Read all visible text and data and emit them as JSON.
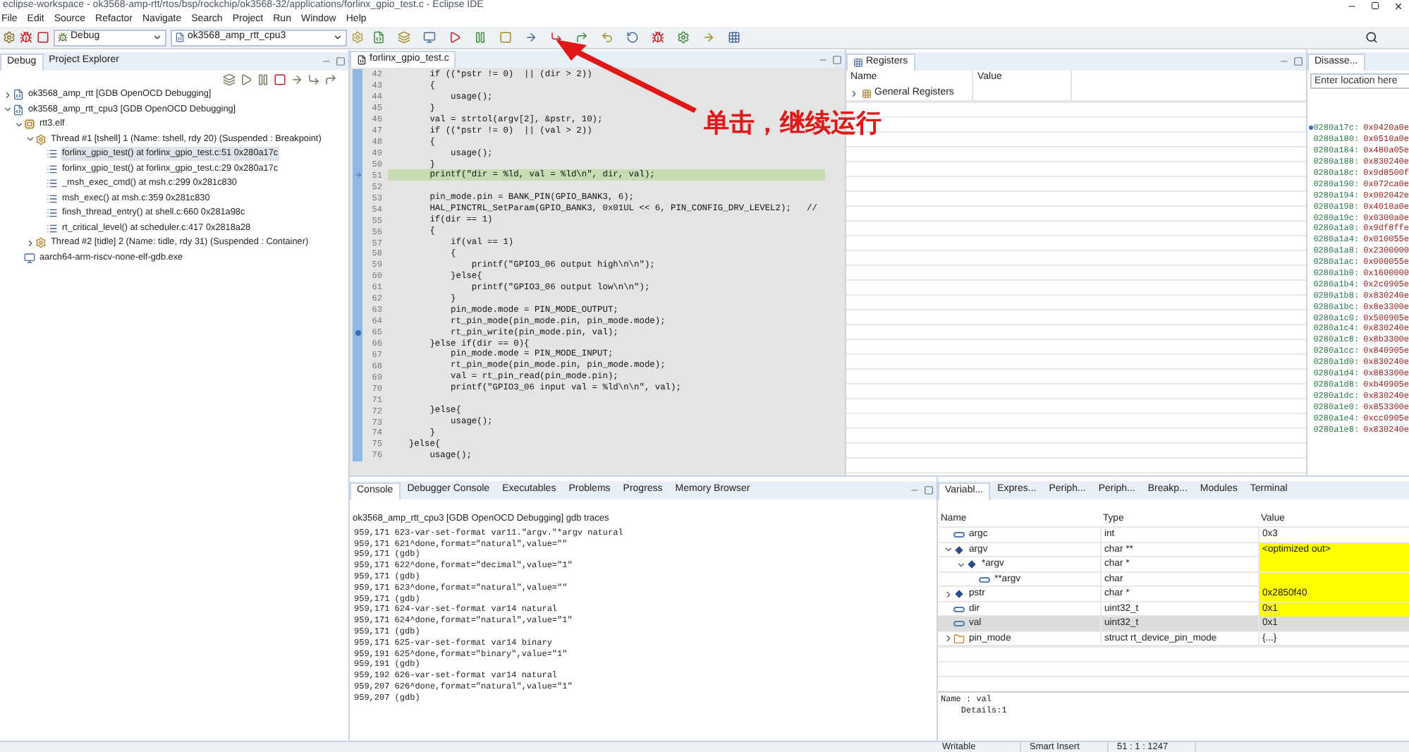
{
  "window": {
    "title": "eclipse-workspace - ok3568-amp-rtt/rtos/bsp/rockchip/ok3568-32/applications/forlinx_gpio_test.c - Eclipse IDE"
  },
  "menu": [
    "File",
    "Edit",
    "Source",
    "Refactor",
    "Navigate",
    "Search",
    "Project",
    "Run",
    "Window",
    "Help"
  ],
  "toolbar": {
    "mode": "Debug",
    "config": "ok3568_amp_rtt_cpu3"
  },
  "debug_panel": {
    "tabs": [
      {
        "label": "Debug",
        "selected": true
      },
      {
        "label": "Project Explorer",
        "selected": false
      }
    ],
    "tree": [
      {
        "label": "ok3568_amp_rtt [GDB OpenOCD Debugging]",
        "kind": "launch",
        "expanded": false,
        "selected": false
      },
      {
        "label": "ok3568_amp_rtt_cpu3 [GDB OpenOCD Debugging]",
        "kind": "launch",
        "expanded": true,
        "selected": false,
        "children": [
          {
            "label": "rtt3.elf",
            "kind": "process",
            "expanded": true,
            "selected": false,
            "children": [
              {
                "label": "Thread #1 [tshell] 1 (Name: tshell, rdy 20) (Suspended : Breakpoint)",
                "kind": "thread",
                "expanded": true,
                "selected": false,
                "children": [
                  {
                    "label": "forlinx_gpio_test() at forlinx_gpio_test.c:51 0x280a17c",
                    "kind": "frame",
                    "selected": true
                  },
                  {
                    "label": "forlinx_gpio_test() at forlinx_gpio_test.c:29 0x280a17c",
                    "kind": "frame",
                    "selected": false
                  },
                  {
                    "label": "_msh_exec_cmd() at msh.c:299 0x281c830",
                    "kind": "frame",
                    "selected": false
                  },
                  {
                    "label": "msh_exec() at msh.c:359 0x281c830",
                    "kind": "frame",
                    "selected": false
                  },
                  {
                    "label": "finsh_thread_entry() at shell.c:660 0x281a98c",
                    "kind": "frame",
                    "selected": false
                  },
                  {
                    "label": "rt_critical_level() at scheduler.c:417 0x2818a28",
                    "kind": "frame",
                    "selected": false
                  }
                ]
              },
              {
                "label": "Thread #2 [tidle] 2 (Name: tidle, rdy 31) (Suspended : Container)",
                "kind": "thread",
                "expanded": false,
                "selected": false
              }
            ]
          },
          {
            "label": "aarch64-arm-riscv-none-elf-gdb.exe",
            "kind": "gdb",
            "selected": false
          }
        ]
      }
    ]
  },
  "editor": {
    "tab": "forlinx_gpio_test.c",
    "lines": [
      {
        "n": "42",
        "code": "        if ((*pstr != 0)  || (dir > 2))",
        "current": false,
        "breakpoint": false
      },
      {
        "n": "43",
        "code": "        {",
        "current": false,
        "breakpoint": false
      },
      {
        "n": "44",
        "code": "            usage();",
        "current": false,
        "breakpoint": false
      },
      {
        "n": "45",
        "code": "        }",
        "current": false,
        "breakpoint": false
      },
      {
        "n": "46",
        "code": "        val = strtol(argv[2], &pstr, 10);",
        "current": false,
        "breakpoint": false
      },
      {
        "n": "47",
        "code": "        if ((*pstr != 0)  || (val > 2))",
        "current": false,
        "breakpoint": false
      },
      {
        "n": "48",
        "code": "        {",
        "current": false,
        "breakpoint": false
      },
      {
        "n": "49",
        "code": "            usage();",
        "current": false,
        "breakpoint": false
      },
      {
        "n": "50",
        "code": "        }",
        "current": false,
        "breakpoint": false
      },
      {
        "n": "51",
        "code": "        printf(\"dir = %ld, val = %ld\\n\", dir, val);",
        "current": true,
        "breakpoint": false
      },
      {
        "n": "52",
        "current": false,
        "breakpoint": false
      },
      {
        "n": "53",
        "code": "        pin_mode.pin = BANK_PIN(GPIO_BANK3, 6);",
        "current": false,
        "breakpoint": false
      },
      {
        "n": "54",
        "code": "        HAL_PINCTRL_SetParam(GPIO_BANK3, 0x01UL << 6, PIN_CONFIG_DRV_LEVEL2);   //",
        "current": false,
        "breakpoint": false
      },
      {
        "n": "55",
        "code": "        if(dir == 1)",
        "current": false,
        "breakpoint": false
      },
      {
        "n": "56",
        "code": "        {",
        "current": false,
        "breakpoint": false
      },
      {
        "n": "57",
        "code": "            if(val == 1)",
        "current": false,
        "breakpoint": false
      },
      {
        "n": "58",
        "code": "            {",
        "current": false,
        "breakpoint": false
      },
      {
        "n": "59",
        "code": "                printf(\"GPIO3_06 output high\\n\\n\");",
        "current": false,
        "breakpoint": false
      },
      {
        "n": "60",
        "code": "            }else{",
        "current": false,
        "breakpoint": false
      },
      {
        "n": "61",
        "code": "                printf(\"GPIO3_06 output low\\n\\n\");",
        "current": false,
        "breakpoint": false
      },
      {
        "n": "62",
        "code": "            }",
        "current": false,
        "breakpoint": false
      },
      {
        "n": "63",
        "code": "            pin_mode.mode = PIN_MODE_OUTPUT;",
        "current": false,
        "breakpoint": false
      },
      {
        "n": "64",
        "code": "            rt_pin_mode(pin_mode.pin, pin_mode.mode);",
        "current": false,
        "breakpoint": false
      },
      {
        "n": "65",
        "code": "            rt_pin_write(pin_mode.pin, val);",
        "current": false,
        "breakpoint": true
      },
      {
        "n": "66",
        "code": "        }else if(dir == 0){",
        "current": false,
        "breakpoint": false
      },
      {
        "n": "67",
        "code": "            pin_mode.mode = PIN_MODE_INPUT;",
        "current": false,
        "breakpoint": false
      },
      {
        "n": "68",
        "code": "            rt_pin_mode(pin_mode.pin, pin_mode.mode);",
        "current": false,
        "breakpoint": false
      },
      {
        "n": "69",
        "code": "            val = rt_pin_read(pin_mode.pin);",
        "current": false,
        "breakpoint": false
      },
      {
        "n": "70",
        "code": "            printf(\"GPIO3_06 input val = %ld\\n\\n\", val);",
        "current": false,
        "breakpoint": false
      },
      {
        "n": "71",
        "current": false,
        "breakpoint": false
      },
      {
        "n": "72",
        "code": "        }else{",
        "current": false,
        "breakpoint": false
      },
      {
        "n": "73",
        "code": "            usage();",
        "current": false,
        "breakpoint": false
      },
      {
        "n": "74",
        "code": "        }",
        "current": false,
        "breakpoint": false
      },
      {
        "n": "75",
        "code": "    }else{",
        "current": false,
        "breakpoint": false
      },
      {
        "n": "76",
        "code": "        usage();",
        "current": false,
        "breakpoint": false
      }
    ]
  },
  "registers": {
    "tab": "Registers",
    "columns": [
      "Name",
      "Value"
    ],
    "rows": [
      {
        "name": "General Registers",
        "expanded": false
      }
    ]
  },
  "disassembly": {
    "tab": "Disasse...",
    "location_placeholder": "Enter location here",
    "lines": [
      {
        "addr": "0280a17c:",
        "value": "0x0420a0e",
        "current": true
      },
      {
        "addr": "0280a180:",
        "value": "0x0510a0e",
        "current": false
      },
      {
        "addr": "0280a184:",
        "value": "0x480a05e",
        "current": false
      },
      {
        "addr": "0280a188:",
        "value": "0x830240e",
        "current": false
      },
      {
        "addr": "0280a18c:",
        "value": "0x9d8500f",
        "current": false
      },
      {
        "addr": "0280a190:",
        "value": "0x072ca0e",
        "current": false
      },
      {
        "addr": "0280a194:",
        "value": "0x002042e",
        "current": false
      },
      {
        "addr": "0280a198:",
        "value": "0x4010a0e",
        "current": false
      },
      {
        "addr": "0280a19c:",
        "value": "0x0300a0e",
        "current": false
      },
      {
        "addr": "0280a1a0:",
        "value": "0x9df8ffe",
        "current": false
      },
      {
        "addr": "0280a1a4:",
        "value": "0x010055e",
        "current": false
      },
      {
        "addr": "0280a1a8:",
        "value": "0x2300000",
        "current": false
      },
      {
        "addr": "0280a1ac:",
        "value": "0x000055e",
        "current": false
      },
      {
        "addr": "0280a1b0:",
        "value": "0x1600000",
        "current": false
      },
      {
        "addr": "0280a1b4:",
        "value": "0x2c0905e",
        "current": false
      },
      {
        "addr": "0280a1b8:",
        "value": "0x830240e",
        "current": false
      },
      {
        "addr": "0280a1bc:",
        "value": "0x8e3300e",
        "current": false
      },
      {
        "addr": "0280a1c0:",
        "value": "0x500905e",
        "current": false
      },
      {
        "addr": "0280a1c4:",
        "value": "0x830240e",
        "current": false
      },
      {
        "addr": "0280a1c8:",
        "value": "0x8b3300e",
        "current": false
      },
      {
        "addr": "0280a1cc:",
        "value": "0x840905e",
        "current": false
      },
      {
        "addr": "0280a1d0:",
        "value": "0x830240e",
        "current": false
      },
      {
        "addr": "0280a1d4:",
        "value": "0x883300e",
        "current": false
      },
      {
        "addr": "0280a1d8:",
        "value": "0xb40905e",
        "current": false
      },
      {
        "addr": "0280a1dc:",
        "value": "0x830240e",
        "current": false
      },
      {
        "addr": "0280a1e0:",
        "value": "0x853300e",
        "current": false
      },
      {
        "addr": "0280a1e4:",
        "value": "0xcc0905e",
        "current": false
      },
      {
        "addr": "0280a1e8:",
        "value": "0x830240e",
        "current": false
      }
    ]
  },
  "console": {
    "tabs": [
      {
        "label": "Console",
        "selected": true
      },
      {
        "label": "Debugger Console",
        "selected": false
      },
      {
        "label": "Executables",
        "selected": false
      },
      {
        "label": "Problems",
        "selected": false
      },
      {
        "label": "Progress",
        "selected": false
      },
      {
        "label": "Memory Browser",
        "selected": false
      }
    ],
    "subtitle": "ok3568_amp_rtt_cpu3 [GDB OpenOCD Debugging] gdb traces",
    "lines": [
      "959,171 623-var-set-format var11.\"argv.\"*argv natural",
      "959,171 621^done,format=\"natural\",value=\"\"",
      "959,171 (gdb)",
      "959,171 622^done,format=\"decimal\",value=\"1\"",
      "959,171 (gdb)",
      "959,171 623^done,format=\"natural\",value=\"\"",
      "959,171 (gdb)",
      "959,171 624-var-set-format var14 natural",
      "959,171 624^done,format=\"natural\",value=\"1\"",
      "959,171 (gdb)",
      "959,171 625-var-set-format var14 binary",
      "959,191 625^done,format=\"binary\",value=\"1\"",
      "959,191 (gdb)",
      "959,192 626-var-set-format var14 natural",
      "959,207 626^done,format=\"natural\",value=\"1\"",
      "959,207 (gdb)"
    ]
  },
  "variables": {
    "tabs": [
      {
        "label": "Variabl...",
        "selected": true
      },
      {
        "label": "Expres...",
        "selected": false
      },
      {
        "label": "Periph...",
        "selected": false
      },
      {
        "label": "Periph...",
        "selected": false
      },
      {
        "label": "Breakp...",
        "selected": false
      },
      {
        "label": "Modules",
        "selected": false
      },
      {
        "label": "Terminal",
        "selected": false
      }
    ],
    "columns": [
      "Name",
      "Type",
      "Value"
    ],
    "rows": [
      {
        "name": "argc",
        "type": "int",
        "value": "0x3",
        "kind": "primitive",
        "changed": false,
        "selected": false
      },
      {
        "name": "argv",
        "type": "char **",
        "value": "<optimized out>",
        "kind": "pointer",
        "expanded": true,
        "changed": true,
        "selected": false,
        "children": [
          {
            "name": "*argv",
            "type": "char *",
            "kind": "pointer",
            "expanded": true,
            "changed": true,
            "selected": false,
            "children": [
              {
                "name": "**argv",
                "type": "char",
                "kind": "primitive",
                "changed": true,
                "selected": false
              }
            ]
          }
        ]
      },
      {
        "name": "pstr",
        "type": "char *",
        "value": "0x2850f40",
        "kind": "pointer",
        "expanded": false,
        "changed": true,
        "selected": false
      },
      {
        "name": "dir",
        "type": "uint32_t",
        "value": "0x1",
        "kind": "primitive",
        "changed": true,
        "selected": false
      },
      {
        "name": "val",
        "type": "uint32_t",
        "value": "0x1",
        "kind": "primitive",
        "changed": false,
        "selected": true
      },
      {
        "name": "pin_mode",
        "type": "struct rt_device_pin_mode",
        "value": "{...}",
        "kind": "struct",
        "expanded": false,
        "changed": false,
        "selected": false
      }
    ],
    "details": [
      "Name : val",
      "    Details:1"
    ]
  },
  "status_bar": [
    "Writable",
    "Smart Insert",
    "51 : 1 : 1247"
  ],
  "annotation": {
    "text": "单击，继续运行"
  }
}
